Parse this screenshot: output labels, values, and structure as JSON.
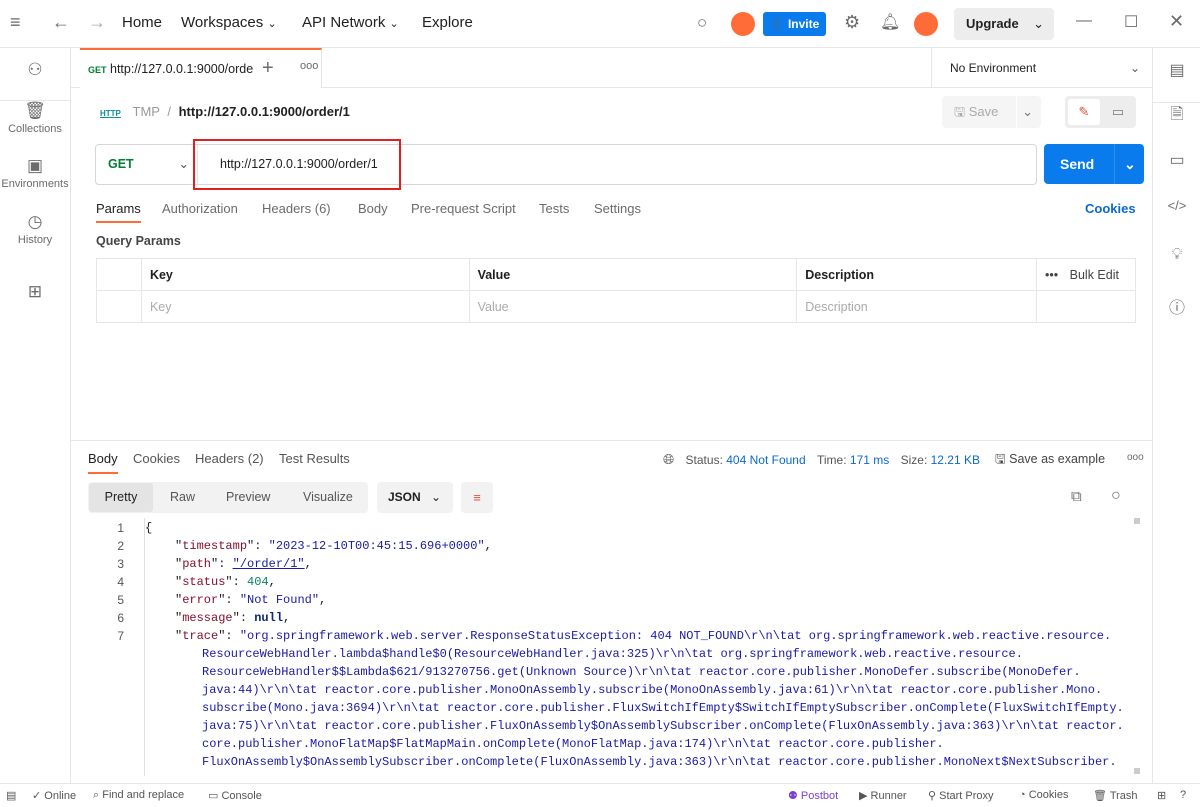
{
  "titlebar": {
    "nav": [
      "Home",
      "Workspaces",
      "API Network",
      "Explore"
    ],
    "invite": "Invite",
    "upgrade": "Upgrade"
  },
  "sidebar": {
    "items": [
      {
        "label": "",
        "icon": "team-icon"
      },
      {
        "label": "Collections",
        "icon": "collections-icon"
      },
      {
        "label": "Environments",
        "icon": "environments-icon"
      },
      {
        "label": "History",
        "icon": "history-icon"
      },
      {
        "label": "",
        "icon": "apps-icon"
      }
    ]
  },
  "tab": {
    "method": "GET",
    "title": "http://127.0.0.1:9000/orde"
  },
  "environment": "No Environment",
  "breadcrumb": {
    "collection": "TMP",
    "sep": "/",
    "name": "http://127.0.0.1:9000/order/1",
    "save": "Save"
  },
  "request": {
    "method": "GET",
    "url": "http://127.0.0.1:9000/order/1",
    "send": "Send",
    "tabs": [
      "Params",
      "Authorization",
      "Headers (6)",
      "Body",
      "Pre-request Script",
      "Tests",
      "Settings"
    ],
    "cookies": "Cookies",
    "query_title": "Query Params",
    "columns": [
      "Key",
      "Value",
      "Description"
    ],
    "bulk_edit": "Bulk Edit",
    "placeholders": [
      "Key",
      "Value",
      "Description"
    ]
  },
  "response": {
    "tabs": [
      "Body",
      "Cookies",
      "Headers (2)",
      "Test Results"
    ],
    "status_label": "Status:",
    "status": "404 Not Found",
    "time_label": "Time:",
    "time": "171 ms",
    "size_label": "Size:",
    "size": "12.21 KB",
    "save_example": "Save as example",
    "views": [
      "Pretty",
      "Raw",
      "Preview",
      "Visualize"
    ],
    "format": "JSON",
    "lines": [
      {
        "n": "1",
        "html": "{"
      },
      {
        "n": "2",
        "k": "timestamp",
        "v": "\"2023-12-10T00:45:15.696+0000\"",
        "t": "str"
      },
      {
        "n": "3",
        "k": "path",
        "v": "\"/order/1\"",
        "t": "str"
      },
      {
        "n": "4",
        "k": "status",
        "v": "404",
        "t": "num"
      },
      {
        "n": "5",
        "k": "error",
        "v": "\"Not Found\"",
        "t": "str"
      },
      {
        "n": "6",
        "k": "message",
        "v": "null",
        "t": "kw"
      },
      {
        "n": "7",
        "k": "trace",
        "v": "\"org.springframework.web.server.ResponseStatusException: 404 NOT_FOUND\\r\\n\\tat org.springframework.web.reactive.resource.",
        "t": "str",
        "nocomma": true
      }
    ],
    "trace_cont": [
      "ResourceWebHandler.lambda$handle$0(ResourceWebHandler.java:325)\\r\\n\\tat org.springframework.web.reactive.resource.",
      "ResourceWebHandler$$Lambda$621/913270756.get(Unknown Source)\\r\\n\\tat reactor.core.publisher.MonoDefer.subscribe(MonoDefer.",
      "java:44)\\r\\n\\tat reactor.core.publisher.MonoOnAssembly.subscribe(MonoOnAssembly.java:61)\\r\\n\\tat reactor.core.publisher.Mono.",
      "subscribe(Mono.java:3694)\\r\\n\\tat reactor.core.publisher.FluxSwitchIfEmpty$SwitchIfEmptySubscriber.onComplete(FluxSwitchIfEmpty.",
      "java:75)\\r\\n\\tat reactor.core.publisher.FluxOnAssembly$OnAssemblySubscriber.onComplete(FluxOnAssembly.java:363)\\r\\n\\tat reactor.",
      "core.publisher.MonoFlatMap$FlatMapMain.onComplete(MonoFlatMap.java:174)\\r\\n\\tat reactor.core.publisher.",
      "FluxOnAssembly$OnAssemblySubscriber.onComplete(FluxOnAssembly.java:363)\\r\\n\\tat reactor.core.publisher.MonoNext$NextSubscriber."
    ]
  },
  "statusbar": {
    "left": [
      "Online",
      "Find and replace",
      "Console"
    ],
    "right": [
      "Postbot",
      "Runner",
      "Start Proxy",
      "Cookies",
      "Trash"
    ]
  },
  "colors": {
    "accent": "#ff6c37",
    "send": "#097bed",
    "get": "#007f31",
    "status_error": "#ab2b24"
  }
}
